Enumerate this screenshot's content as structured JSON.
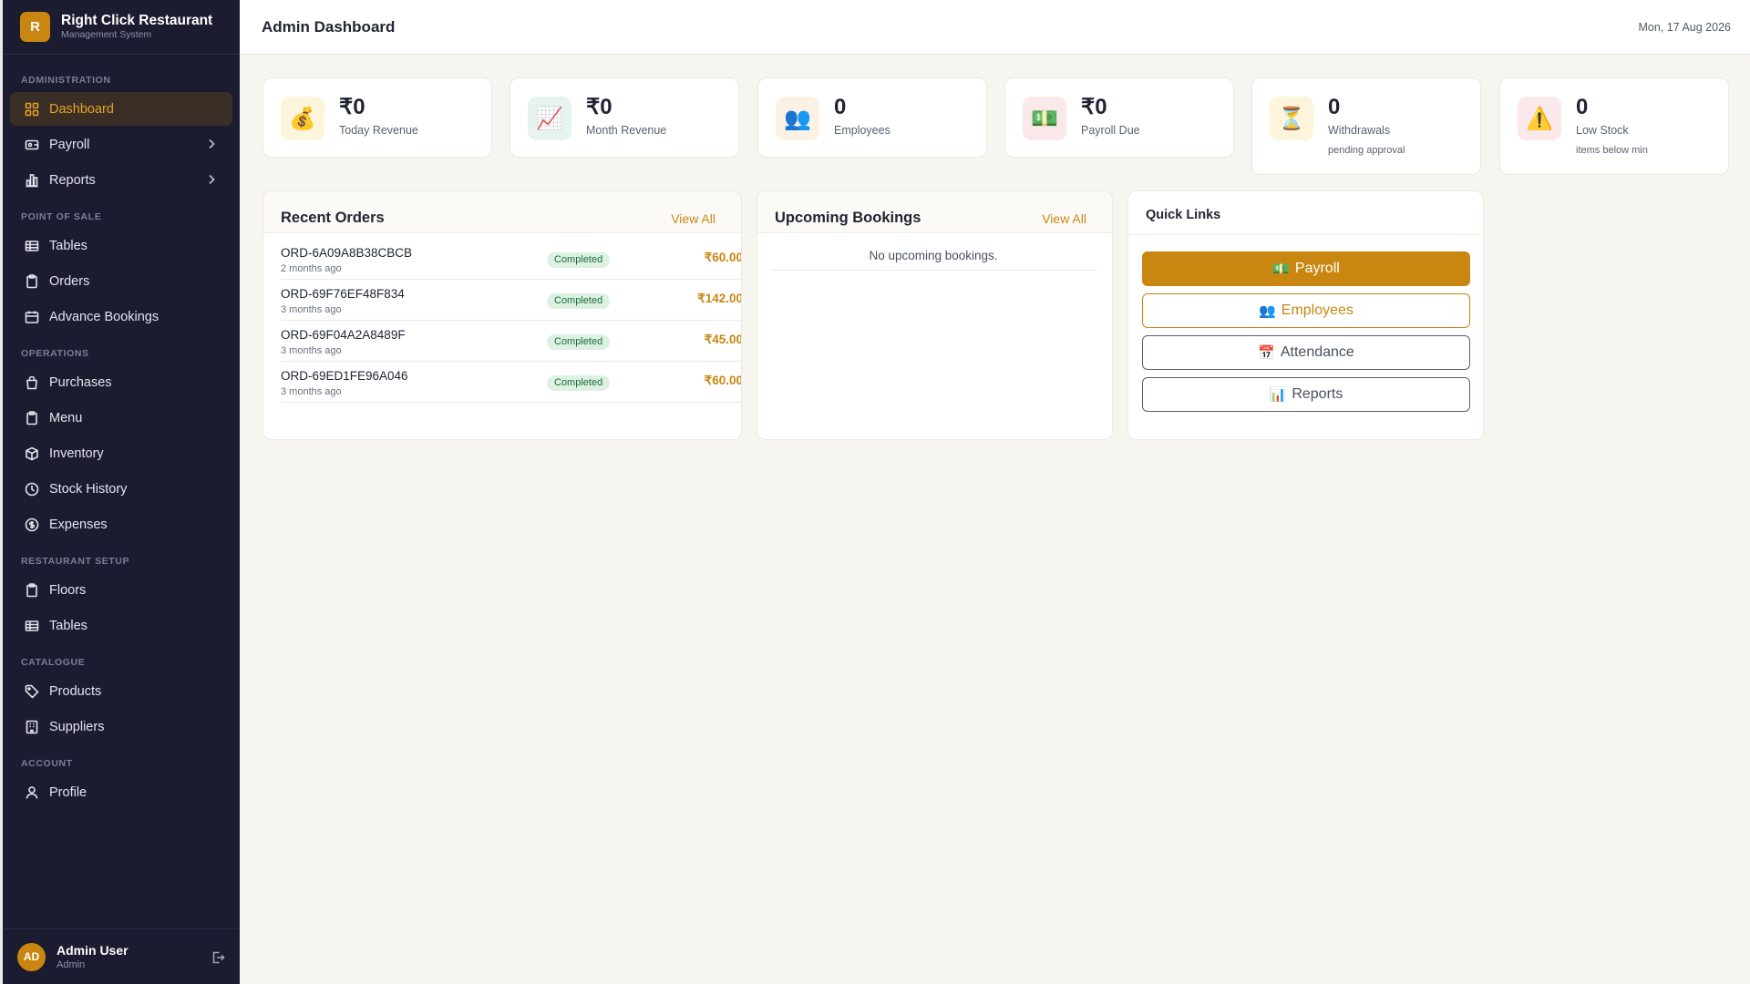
{
  "brand": {
    "logo_letter": "R",
    "title": "Right Click Restaurant",
    "subtitle": "Management System"
  },
  "sidebar": {
    "sections": [
      {
        "label": "Administration",
        "items": [
          {
            "label": "Dashboard",
            "icon": "grid-icon",
            "active": true
          },
          {
            "label": "Payroll",
            "icon": "wallet-icon",
            "chevron": true
          },
          {
            "label": "Reports",
            "icon": "bar-chart-icon",
            "chevron": true
          }
        ]
      },
      {
        "label": "Point of Sale",
        "items": [
          {
            "label": "Tables",
            "icon": "table-icon"
          },
          {
            "label": "Orders",
            "icon": "clipboard-icon"
          },
          {
            "label": "Advance Bookings",
            "icon": "calendar-icon"
          }
        ]
      },
      {
        "label": "Operations",
        "items": [
          {
            "label": "Purchases",
            "icon": "shopping-bag-icon"
          },
          {
            "label": "Menu",
            "icon": "clipboard-icon"
          },
          {
            "label": "Inventory",
            "icon": "box-icon"
          },
          {
            "label": "Stock History",
            "icon": "clock-icon"
          },
          {
            "label": "Expenses",
            "icon": "dollar-circle-icon"
          }
        ]
      },
      {
        "label": "Restaurant Setup",
        "items": [
          {
            "label": "Floors",
            "icon": "clipboard-icon"
          },
          {
            "label": "Tables",
            "icon": "table-icon"
          }
        ]
      },
      {
        "label": "Catalogue",
        "items": [
          {
            "label": "Products",
            "icon": "tag-icon"
          },
          {
            "label": "Suppliers",
            "icon": "building-icon"
          }
        ]
      },
      {
        "label": "Account",
        "items": [
          {
            "label": "Profile",
            "icon": "user-icon"
          }
        ]
      }
    ]
  },
  "user": {
    "initials": "AD",
    "name": "Admin User",
    "role": "Admin"
  },
  "header": {
    "title": "Admin Dashboard",
    "date": "Mon, 17 Aug 2026"
  },
  "stats": [
    {
      "icon": "money-bag-icon",
      "glyph": "💰",
      "value": "₹0",
      "label": "Today Revenue",
      "sub": "",
      "icon_bg": "#fdf4dc"
    },
    {
      "icon": "chart-up-icon",
      "glyph": "📈",
      "value": "₹0",
      "label": "Month Revenue",
      "sub": "",
      "icon_bg": "#e6f3ee"
    },
    {
      "icon": "people-icon",
      "glyph": "👥",
      "value": "0",
      "label": "Employees",
      "sub": "",
      "icon_bg": "#fbf1e4"
    },
    {
      "icon": "banknote-icon",
      "glyph": "💵",
      "value": "₹0",
      "label": "Payroll Due",
      "sub": "",
      "icon_bg": "#fbe8ea"
    },
    {
      "icon": "hourglass-icon",
      "glyph": "⏳",
      "value": "0",
      "label": "Withdrawals",
      "sub": "pending approval",
      "icon_bg": "#fdf4dc"
    },
    {
      "icon": "warning-icon",
      "glyph": "⚠️",
      "value": "0",
      "label": "Low Stock",
      "sub": "items below min",
      "icon_bg": "#fbe8ea"
    }
  ],
  "recent_orders": {
    "title": "Recent Orders",
    "view_all": "View All",
    "rows": [
      {
        "id": "ORD-6A09A8B38CBCB",
        "time": "2 months ago",
        "status": "Completed",
        "amount": "₹60.00"
      },
      {
        "id": "ORD-69F76EF48F834",
        "time": "3 months ago",
        "status": "Completed",
        "amount": "₹142.00"
      },
      {
        "id": "ORD-69F04A2A8489F",
        "time": "3 months ago",
        "status": "Completed",
        "amount": "₹45.00"
      },
      {
        "id": "ORD-69ED1FE96A046",
        "time": "3 months ago",
        "status": "Completed",
        "amount": "₹60.00"
      }
    ]
  },
  "bookings": {
    "title": "Upcoming Bookings",
    "view_all": "View All",
    "empty": "No upcoming bookings."
  },
  "quick_links": {
    "title": "Quick Links",
    "items": [
      {
        "label": "Payroll",
        "icon": "banknote-icon",
        "glyph": "💵",
        "style": "primary"
      },
      {
        "label": "Employees",
        "icon": "people-icon",
        "glyph": "👥",
        "style": "outline-gold"
      },
      {
        "label": "Attendance",
        "icon": "calendar-icon",
        "glyph": "📅",
        "style": "outline-gray"
      },
      {
        "label": "Reports",
        "icon": "bar-chart-icon",
        "glyph": "📊",
        "style": "outline-gray"
      }
    ]
  },
  "colors": {
    "accent": "#c98611",
    "sidebar_bg": "#1b1c30",
    "page_bg": "#f7f5ef",
    "badge_bg": "#dcf1e2",
    "badge_text": "#1c6b3a"
  }
}
